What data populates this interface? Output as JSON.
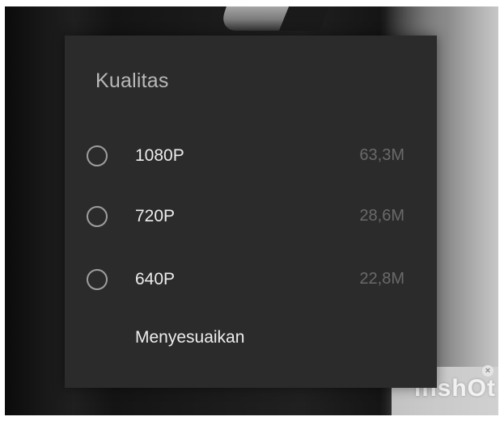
{
  "dialog": {
    "title": "Kualitas",
    "options": [
      {
        "label": "1080P",
        "size": "63,3M",
        "selected": false
      },
      {
        "label": "720P",
        "size": "28,6M",
        "selected": false
      },
      {
        "label": "640P",
        "size": "22,8M",
        "selected": false
      }
    ],
    "custom_label": "Menyesuaikan"
  },
  "watermark": {
    "text": "inshOt"
  },
  "colors": {
    "dialog_bg": "#2b2b2b",
    "title": "#b9b9b9",
    "label": "#ededed",
    "size": "#6a6a6a",
    "radio": "#9e9e9e"
  }
}
